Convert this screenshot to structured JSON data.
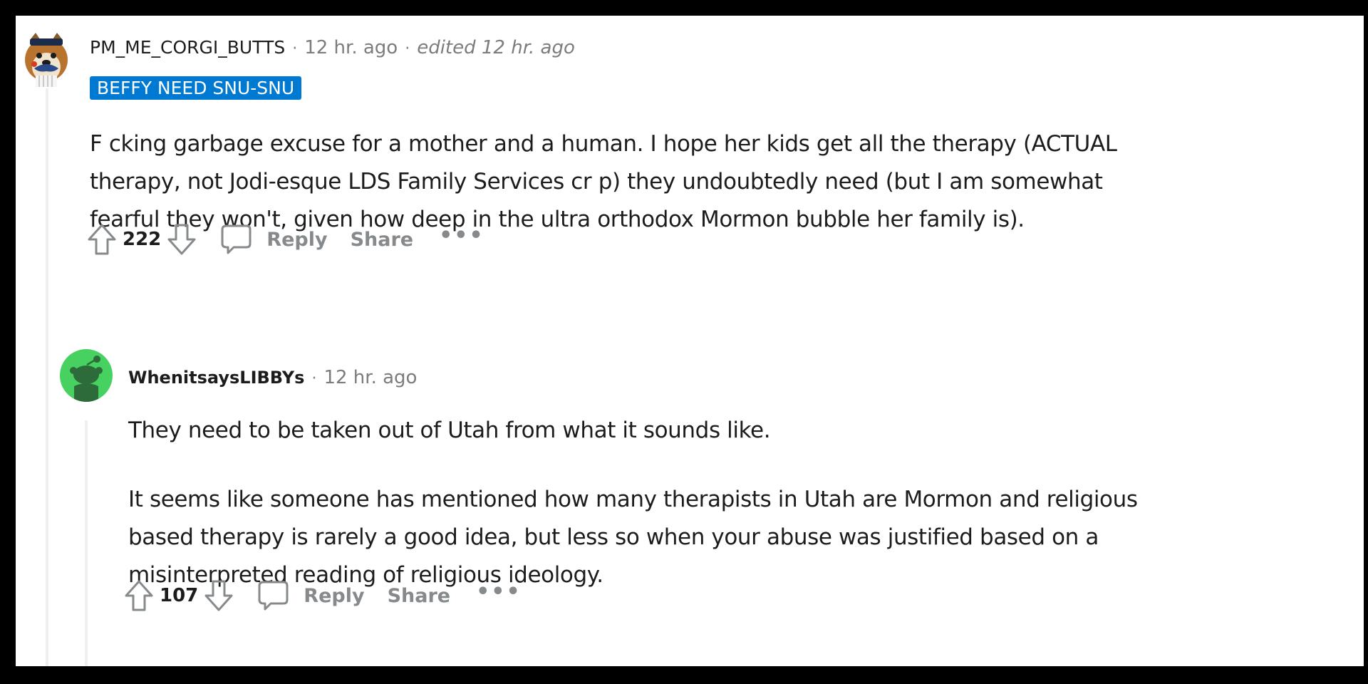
{
  "comments": [
    {
      "username": "PM_ME_CORGI_BUTTS",
      "separator": "·",
      "timestamp": "12 hr. ago",
      "edited": "edited 12 hr. ago",
      "flair": "BEFFY NEED SNU-SNU",
      "avatar_icon": "corgi-avatar-icon",
      "body": [
        "F  cking garbage excuse for a mother and a human. I hope her kids get all the therapy (ACTUAL",
        "therapy, not Jodi-esque LDS Family Services cr  p) they undoubtedly need (but I am somewhat",
        "fearful they won't, given how deep in the ultra orthodox Mormon bubble her family is)."
      ],
      "score": "222",
      "reply_label": "Reply",
      "share_label": "Share",
      "more_label": "•••"
    },
    {
      "username": "WhenitsaysLIBBYs",
      "separator": "·",
      "timestamp": "12 hr. ago",
      "avatar_icon": "snoo-avatar-icon",
      "avatar_color": "#46d160",
      "body_paragraph_1": "They need to be taken out of Utah from what it sounds like.",
      "body_paragraph_2": [
        "It seems like someone has mentioned how many therapists in Utah are Mormon and religious",
        "based therapy is rarely a good idea, but less so when your abuse was justified based on a",
        "misinterpreted reading of religious ideology."
      ],
      "score": "107",
      "reply_label": "Reply",
      "share_label": "Share",
      "more_label": "•••"
    }
  ],
  "colors": {
    "frame": "#000000",
    "flair_bg": "#0079d3",
    "meta_text": "#7c7c7c",
    "action_text": "#878a8c",
    "thread_line": "#edeff1"
  }
}
